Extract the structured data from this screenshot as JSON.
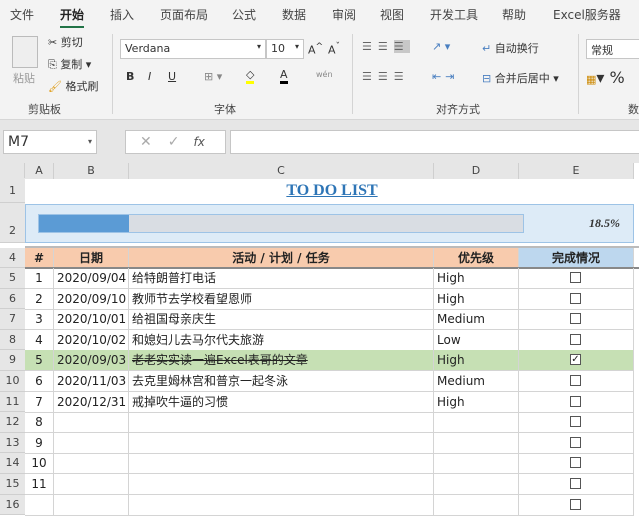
{
  "menu_tabs": [
    "文件",
    "开始",
    "插入",
    "页面布局",
    "公式",
    "数据",
    "审阅",
    "视图",
    "开发工具",
    "帮助",
    "Excel服务器"
  ],
  "active_tab": "开始",
  "ribbon": {
    "clipboard": {
      "paste": "粘贴",
      "cut": "剪切",
      "copy": "复制",
      "format_painter": "格式刷",
      "group": "剪贴板"
    },
    "font": {
      "name": "Verdana",
      "size": "10",
      "group": "字体",
      "bold": "B",
      "italic": "I",
      "underline": "U",
      "font_color": "A"
    },
    "alignment": {
      "wrap": "自动换行",
      "merge": "合并后居中",
      "group": "对齐方式"
    },
    "number": {
      "format": "常规",
      "percent": "%",
      "group": "数"
    }
  },
  "formula_bar": {
    "name_box": "M7",
    "fx": "fx",
    "formula": ""
  },
  "columns": [
    "A",
    "B",
    "C",
    "D",
    "E"
  ],
  "title": "TO DO LIST",
  "progress": {
    "value": 18.5,
    "label": "18.5%",
    "fill_color": "#5b9bd5"
  },
  "headers": [
    "#",
    "日期",
    "活动 / 计划 / 任务",
    "优先级",
    "完成情况"
  ],
  "row_numbers": [
    "1",
    "2",
    "4",
    "5",
    "6",
    "7",
    "8",
    "9",
    "10",
    "11",
    "12",
    "13",
    "14",
    "15",
    "16"
  ],
  "tasks": [
    {
      "n": "1",
      "date": "2020/09/04",
      "task": "给特朗普打电话",
      "priority": "High",
      "done": false
    },
    {
      "n": "2",
      "date": "2020/09/10",
      "task": "教师节去学校看望恩师",
      "priority": "High",
      "done": false
    },
    {
      "n": "3",
      "date": "2020/10/01",
      "task": "给祖国母亲庆生",
      "priority": "Medium",
      "done": false
    },
    {
      "n": "4",
      "date": "2020/10/02",
      "task": "和媳妇儿去马尔代夫旅游",
      "priority": "Low",
      "done": false
    },
    {
      "n": "5",
      "date": "2020/09/03",
      "task": "老老实实读一遍Excel表哥的文章",
      "priority": "High",
      "done": true
    },
    {
      "n": "6",
      "date": "2020/11/03",
      "task": "去克里姆林宫和普京一起冬泳",
      "priority": "Medium",
      "done": false
    },
    {
      "n": "7",
      "date": "2020/12/31",
      "task": "戒掉吹牛逼的习惯",
      "priority": "High",
      "done": false
    },
    {
      "n": "8",
      "date": "",
      "task": "",
      "priority": "",
      "done": false
    },
    {
      "n": "9",
      "date": "",
      "task": "",
      "priority": "",
      "done": false
    },
    {
      "n": "10",
      "date": "",
      "task": "",
      "priority": "",
      "done": false
    },
    {
      "n": "11",
      "date": "",
      "task": "",
      "priority": "",
      "done": false
    },
    {
      "n": "",
      "date": "",
      "task": "",
      "priority": "",
      "done": false
    }
  ],
  "colors": {
    "header_bg": "#f8cbad",
    "done_header_bg": "#bdd7ee",
    "done_row_bg": "#c6e0b4",
    "progress_bg": "#ddebf7",
    "title": "#2e75b6"
  }
}
